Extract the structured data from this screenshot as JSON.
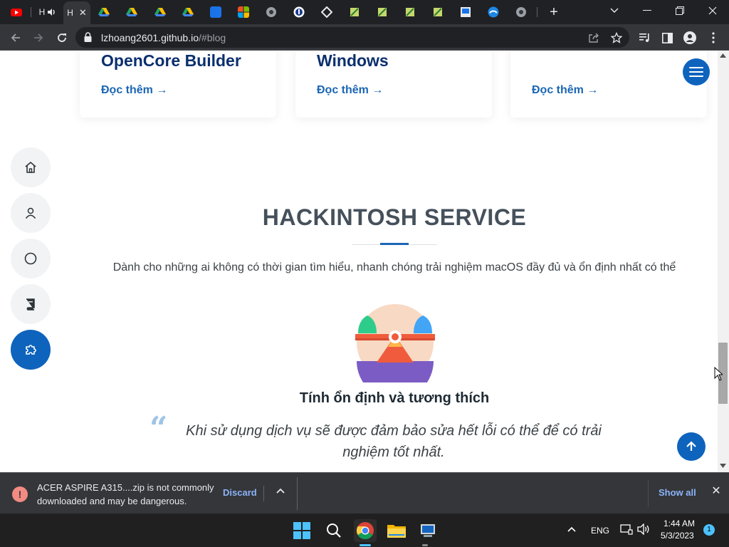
{
  "browser": {
    "tabs": [
      {
        "icon": "youtube-icon",
        "color": "#ff0000",
        "label": ""
      },
      {
        "icon": "audio-icon",
        "color": "#e8eaed",
        "label": "H"
      },
      {
        "icon": "close-icon",
        "color": "#e8eaed",
        "label": "H",
        "active": true,
        "close": "✕"
      },
      {
        "icon": "google-drive-icon",
        "color": "#1fa463",
        "label": ""
      },
      {
        "icon": "google-drive-icon",
        "color": "#1fa463",
        "label": ""
      },
      {
        "icon": "google-drive-icon",
        "color": "#1fa463",
        "label": ""
      },
      {
        "icon": "google-drive-icon",
        "color": "#1fa463",
        "label": ""
      },
      {
        "icon": "vn-site-icon",
        "color": "#1a73e8",
        "label": ""
      },
      {
        "icon": "microsoft-icon",
        "color": "#f25022",
        "label": ""
      },
      {
        "icon": "globe-icon",
        "color": "#9aa0a6",
        "label": ""
      },
      {
        "icon": "circle-logo-icon",
        "color": "#1a73e8",
        "label": ""
      },
      {
        "icon": "diamond-logo-icon",
        "color": "#e8eaed",
        "label": ""
      },
      {
        "icon": "flag-icon",
        "color": "#8bc34a",
        "label": ""
      },
      {
        "icon": "flag-icon",
        "color": "#8bc34a",
        "label": ""
      },
      {
        "icon": "flag-icon",
        "color": "#8bc34a",
        "label": ""
      },
      {
        "icon": "flag-icon",
        "color": "#8bc34a",
        "label": ""
      },
      {
        "icon": "monitor-icon",
        "color": "#e8eaed",
        "label": ""
      },
      {
        "icon": "blue-logo-icon",
        "color": "#1e88e5",
        "label": ""
      },
      {
        "icon": "globe-icon",
        "color": "#9aa0a6",
        "label": ""
      }
    ],
    "url_host": "lzhoang2601.github.io",
    "url_path": "/#blog"
  },
  "page": {
    "cards": [
      {
        "title": "OpenCore Builder",
        "more": "Đọc thêm →"
      },
      {
        "title": "Windows",
        "more": "Đọc thêm →"
      },
      {
        "title": "",
        "more": "Đọc thêm →"
      }
    ],
    "section": {
      "title": "HACKINTOSH SERVICE",
      "description": "Dành cho những ai không có thời gian tìm hiểu, nhanh chóng trải nghiệm macOS đầy đủ và ổn định nhất có thể",
      "service_title": "Tính ổn định và tương thích",
      "quote_mark": "“",
      "quote": "Khi sử dụng dịch vụ sẽ được đảm bảo sửa hết lỗi có thể để có trải nghiệm tốt nhất."
    },
    "sidebar_items": [
      "home-icon",
      "user-icon",
      "circle-icon",
      "book-icon",
      "puzzle-icon"
    ],
    "colors": {
      "primary": "#0e63bd",
      "card_title": "#0b2f6e",
      "link": "#1b66b5",
      "heading": "#45505b"
    }
  },
  "download_bar": {
    "warning": "!",
    "message": "ACER ASPIRE A315....zip is not commonly downloaded and may be dangerous.",
    "discard": "Discard",
    "show_all": "Show all",
    "close": "✕"
  },
  "taskbar": {
    "language": "ENG",
    "time": "1:44 AM",
    "date": "5/3/2023",
    "notifications": "1",
    "apps": [
      "windows-start-icon",
      "search-icon",
      "chrome-icon",
      "file-explorer-icon",
      "app-icon"
    ]
  }
}
